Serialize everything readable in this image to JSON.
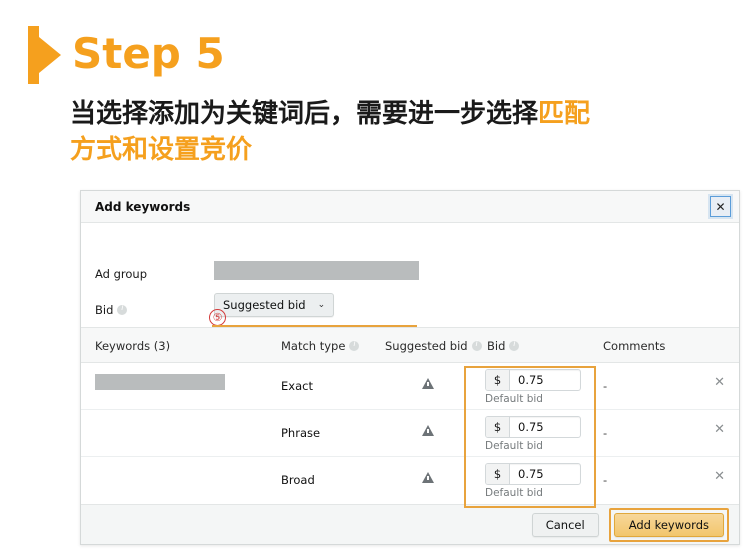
{
  "slide": {
    "step_title": "Step 5",
    "description_part1": "当选择添加为关键词后，需要进一步选择",
    "description_highlight1": "匹配",
    "description_highlight2": "方式和设置竞价"
  },
  "annotation": {
    "step_marker": "⑤"
  },
  "dialog": {
    "title": "Add keywords",
    "close_label": "✕",
    "fields": {
      "ad_group_label": "Ad group",
      "ad_group_value": "",
      "bid_label": "Bid",
      "bid_select_value": "Suggested bid",
      "chevron": "⌄",
      "match_type_label": "Match type"
    },
    "match_types": [
      {
        "label": "Exact",
        "checked": true
      },
      {
        "label": "Phrase",
        "checked": true
      },
      {
        "label": "Broad",
        "checked": true
      }
    ],
    "table": {
      "headers": {
        "keywords": "Keywords (3)",
        "match_type": "Match type",
        "suggested_bid": "Suggested bid",
        "bid": "Bid",
        "comments": "Comments"
      },
      "rows": [
        {
          "keyword": "",
          "match_type": "Exact",
          "suggested_bid": "",
          "bid_currency": "$",
          "bid_value": "0.75",
          "bid_sublabel": "Default bid",
          "comments": "-",
          "delete": "✕"
        },
        {
          "keyword": "",
          "match_type": "Phrase",
          "suggested_bid": "",
          "bid_currency": "$",
          "bid_value": "0.75",
          "bid_sublabel": "Default bid",
          "comments": "-",
          "delete": "✕"
        },
        {
          "keyword": "",
          "match_type": "Broad",
          "suggested_bid": "",
          "bid_currency": "$",
          "bid_value": "0.75",
          "bid_sublabel": "Default bid",
          "comments": "-",
          "delete": "✕"
        }
      ]
    },
    "footer": {
      "cancel_label": "Cancel",
      "add_label": "Add keywords"
    }
  },
  "colors": {
    "accent_orange": "#F5A01E",
    "highlight_orange": "#E8A33D",
    "annotation_red": "#D43C3C",
    "placeholder_gray": "#b9bcbd"
  }
}
